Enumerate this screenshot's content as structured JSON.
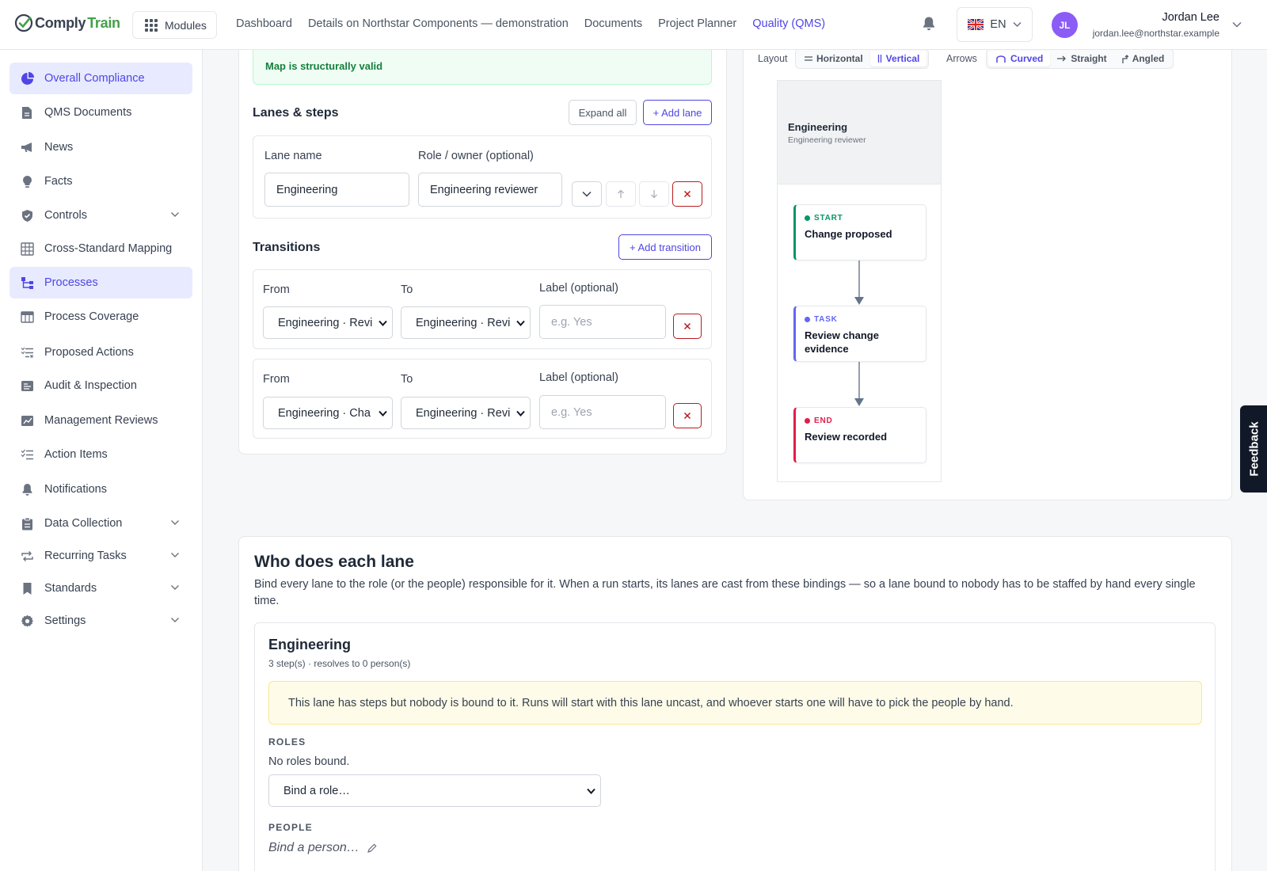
{
  "app": {
    "logo_part1": "Comply",
    "logo_part2": "Train",
    "modules_label": "Modules"
  },
  "topnav": [
    {
      "label": "Dashboard",
      "active": false
    },
    {
      "label": "Details on Northstar Components — demonstration",
      "active": false
    },
    {
      "label": "Documents",
      "active": false
    },
    {
      "label": "Project Planner",
      "active": false
    },
    {
      "label": "Quality (QMS)",
      "active": true
    }
  ],
  "header": {
    "lang": "EN",
    "avatar_initials": "JL",
    "user_name": "Jordan Lee",
    "user_email": "jordan.lee@northstar.example"
  },
  "sidebar": [
    {
      "label": "Overall Compliance",
      "icon": "pie-chart-icon",
      "active": true,
      "expandable": false
    },
    {
      "label": "QMS Documents",
      "icon": "document-icon",
      "active": false,
      "expandable": false
    },
    {
      "label": "News",
      "icon": "megaphone-icon",
      "active": false,
      "expandable": false
    },
    {
      "label": "Facts",
      "icon": "lightbulb-icon",
      "active": false,
      "expandable": false
    },
    {
      "label": "Controls",
      "icon": "shield-check-icon",
      "active": false,
      "expandable": true
    },
    {
      "label": "Cross-Standard Mapping",
      "icon": "table-grid-icon",
      "active": false,
      "expandable": false
    },
    {
      "label": "Processes",
      "icon": "process-icon",
      "active": true,
      "expandable": false
    },
    {
      "label": "Process Coverage",
      "icon": "table-icon",
      "active": false,
      "expandable": false
    },
    {
      "label": "Proposed Actions",
      "icon": "checklist-x-icon",
      "active": false,
      "expandable": false
    },
    {
      "label": "Audit & Inspection",
      "icon": "audit-icon",
      "active": false,
      "expandable": false
    },
    {
      "label": "Management Reviews",
      "icon": "chart-review-icon",
      "active": false,
      "expandable": false
    },
    {
      "label": "Action Items",
      "icon": "checklist-icon",
      "active": false,
      "expandable": false
    },
    {
      "label": "Notifications",
      "icon": "bell-icon",
      "active": false,
      "expandable": false
    },
    {
      "label": "Data Collection",
      "icon": "clipboard-icon",
      "active": false,
      "expandable": true
    },
    {
      "label": "Recurring Tasks",
      "icon": "repeat-icon",
      "active": false,
      "expandable": true
    },
    {
      "label": "Standards",
      "icon": "bookmark-icon",
      "active": false,
      "expandable": true
    },
    {
      "label": "Settings",
      "icon": "gear-icon",
      "active": false,
      "expandable": true
    }
  ],
  "editor": {
    "valid_msg": "Map is structurally valid",
    "lanes_title": "Lanes & steps",
    "expand_all": "Expand all",
    "add_lane": "+ Add lane",
    "lane_name_label": "Lane name",
    "role_label": "Role / owner (optional)",
    "lane_name_value": "Engineering",
    "role_value": "Engineering reviewer",
    "transitions_title": "Transitions",
    "add_transition": "+ Add transition",
    "transitions": [
      {
        "from_label": "From",
        "to_label": "To",
        "label_label": "Label (optional)",
        "from": "Engineering · Revi",
        "to": "Engineering · Revi",
        "placeholder": "e.g. Yes"
      },
      {
        "from_label": "From",
        "to_label": "To",
        "label_label": "Label (optional)",
        "from": "Engineering · Cha",
        "to": "Engineering · Revi",
        "placeholder": "e.g. Yes"
      }
    ]
  },
  "diagram": {
    "layout_label": "Layout",
    "layout_options": [
      "Horizontal",
      "Vertical"
    ],
    "layout_selected": "Vertical",
    "arrows_label": "Arrows",
    "arrow_options": [
      "Curved",
      "Straight",
      "Angled"
    ],
    "arrow_selected": "Curved",
    "lane_name": "Engineering",
    "lane_role": "Engineering reviewer",
    "nodes": [
      {
        "kind": "START",
        "title": "Change proposed",
        "color": "#059669"
      },
      {
        "kind": "TASK",
        "title": "Review change evidence",
        "color": "#6366f1"
      },
      {
        "kind": "END",
        "title": "Review recorded",
        "color": "#e11d48"
      }
    ]
  },
  "who": {
    "title": "Who does each lane",
    "description": "Bind every lane to the role (or the people) responsible for it. When a run starts, its lanes are cast from these bindings — so a lane bound to nobody has to be staffed by hand every single time.",
    "lane_title": "Engineering",
    "lane_meta": "3 step(s) · resolves to 0 person(s)",
    "warning": "This lane has steps but nobody is bound to it. Runs will start with this lane uncast, and whoever starts one will have to pick the people by hand.",
    "roles_heading": "ROLES",
    "no_roles": "No roles bound.",
    "bind_role": "Bind a role…",
    "people_heading": "PEOPLE",
    "bind_person": "Bind a person…"
  },
  "feedback": "Feedback",
  "colors": {
    "accent": "#4f46e5",
    "success": "#15803d",
    "danger": "#b91c1c",
    "brand_green": "#43a047"
  }
}
